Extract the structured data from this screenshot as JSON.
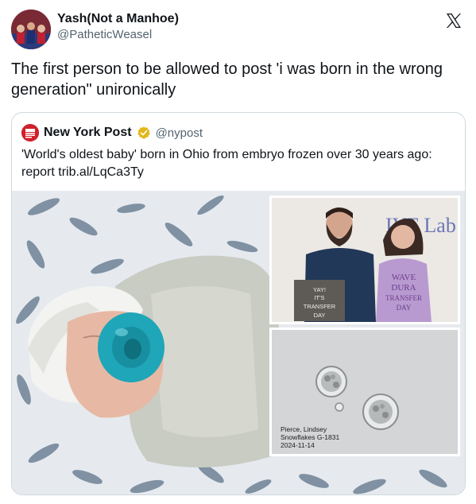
{
  "author": {
    "display_name": "Yash(Not a Manhoe)",
    "handle": "@PatheticWeasel"
  },
  "tweet": {
    "text": "The first person to be allowed to post 'i was born in the wrong generation\" unironically"
  },
  "quote": {
    "display_name": "New York Post",
    "handle": "@nypost",
    "text": "'World's oldest baby' born in Ohio from embryo frozen over 30 years ago: report trib.al/LqCa3Ty"
  },
  "media": {
    "clinic_sign": "IVF Lab",
    "couple_sign": [
      "YAY!",
      "IT'S",
      "TRANSFER",
      "DAY"
    ],
    "shirt_text": [
      "WAVE",
      "DURA",
      "TRANSFER",
      "DAY"
    ],
    "microscope_label": [
      "Pierce, Lindsey",
      "Snowflakes G-1831",
      "2024-11-14"
    ]
  },
  "icons": {
    "x_logo": "x-logo-icon",
    "verified": "verified-badge-icon"
  },
  "colors": {
    "verified_gold": "#e2b719",
    "nypost_red": "#d0202b",
    "pacifier_teal": "#1fa6b8"
  }
}
